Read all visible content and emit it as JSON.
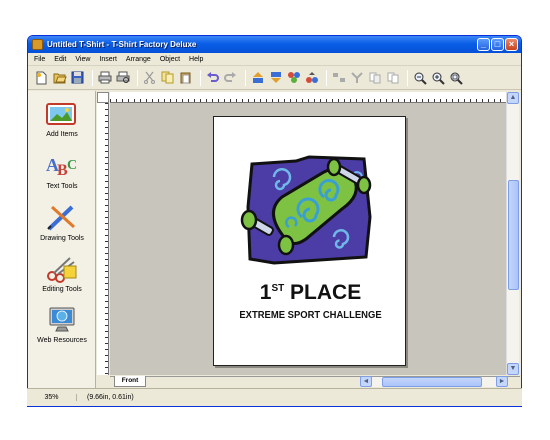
{
  "window": {
    "title": "Untitled T-Shirt - T-Shirt Factory Deluxe"
  },
  "menu": [
    "File",
    "Edit",
    "View",
    "Insert",
    "Arrange",
    "Object",
    "Help"
  ],
  "toolbar_icons": [
    "new-icon",
    "open-icon",
    "save-icon",
    "print-icon",
    "print-preview-icon",
    "cut-icon",
    "copy-icon",
    "paste-icon",
    "undo-icon",
    "redo-icon",
    "bring-forward-icon",
    "send-backward-icon",
    "group-icon",
    "ungroup-icon",
    "align-icon",
    "rotate-icon",
    "flip-icon",
    "duplicate-icon",
    "zoom-out-icon",
    "zoom-in-icon",
    "zoom-fit-icon"
  ],
  "sidebar": {
    "items": [
      {
        "label": "Add Items",
        "icon": "add-items-icon"
      },
      {
        "label": "Text Tools",
        "icon": "text-tools-icon"
      },
      {
        "label": "Drawing Tools",
        "icon": "drawing-tools-icon"
      },
      {
        "label": "Editing Tools",
        "icon": "editing-tools-icon"
      },
      {
        "label": "Web Resources",
        "icon": "web-resources-icon"
      }
    ]
  },
  "design": {
    "headline_number": "1",
    "headline_sup": "ST",
    "headline_word": " PLACE",
    "subtitle": "EXTREME SPORT CHALLENGE"
  },
  "tabs": {
    "front": "Front"
  },
  "status": {
    "zoom": "35%",
    "coords": "(9.66in, 0.61in)"
  },
  "colors": {
    "title_bar": "#0a5ee6",
    "canvas_bg": "#c8c5bc",
    "art_purple": "#4b3ca6",
    "art_green": "#7ec243",
    "art_teal": "#3a9fd3"
  }
}
